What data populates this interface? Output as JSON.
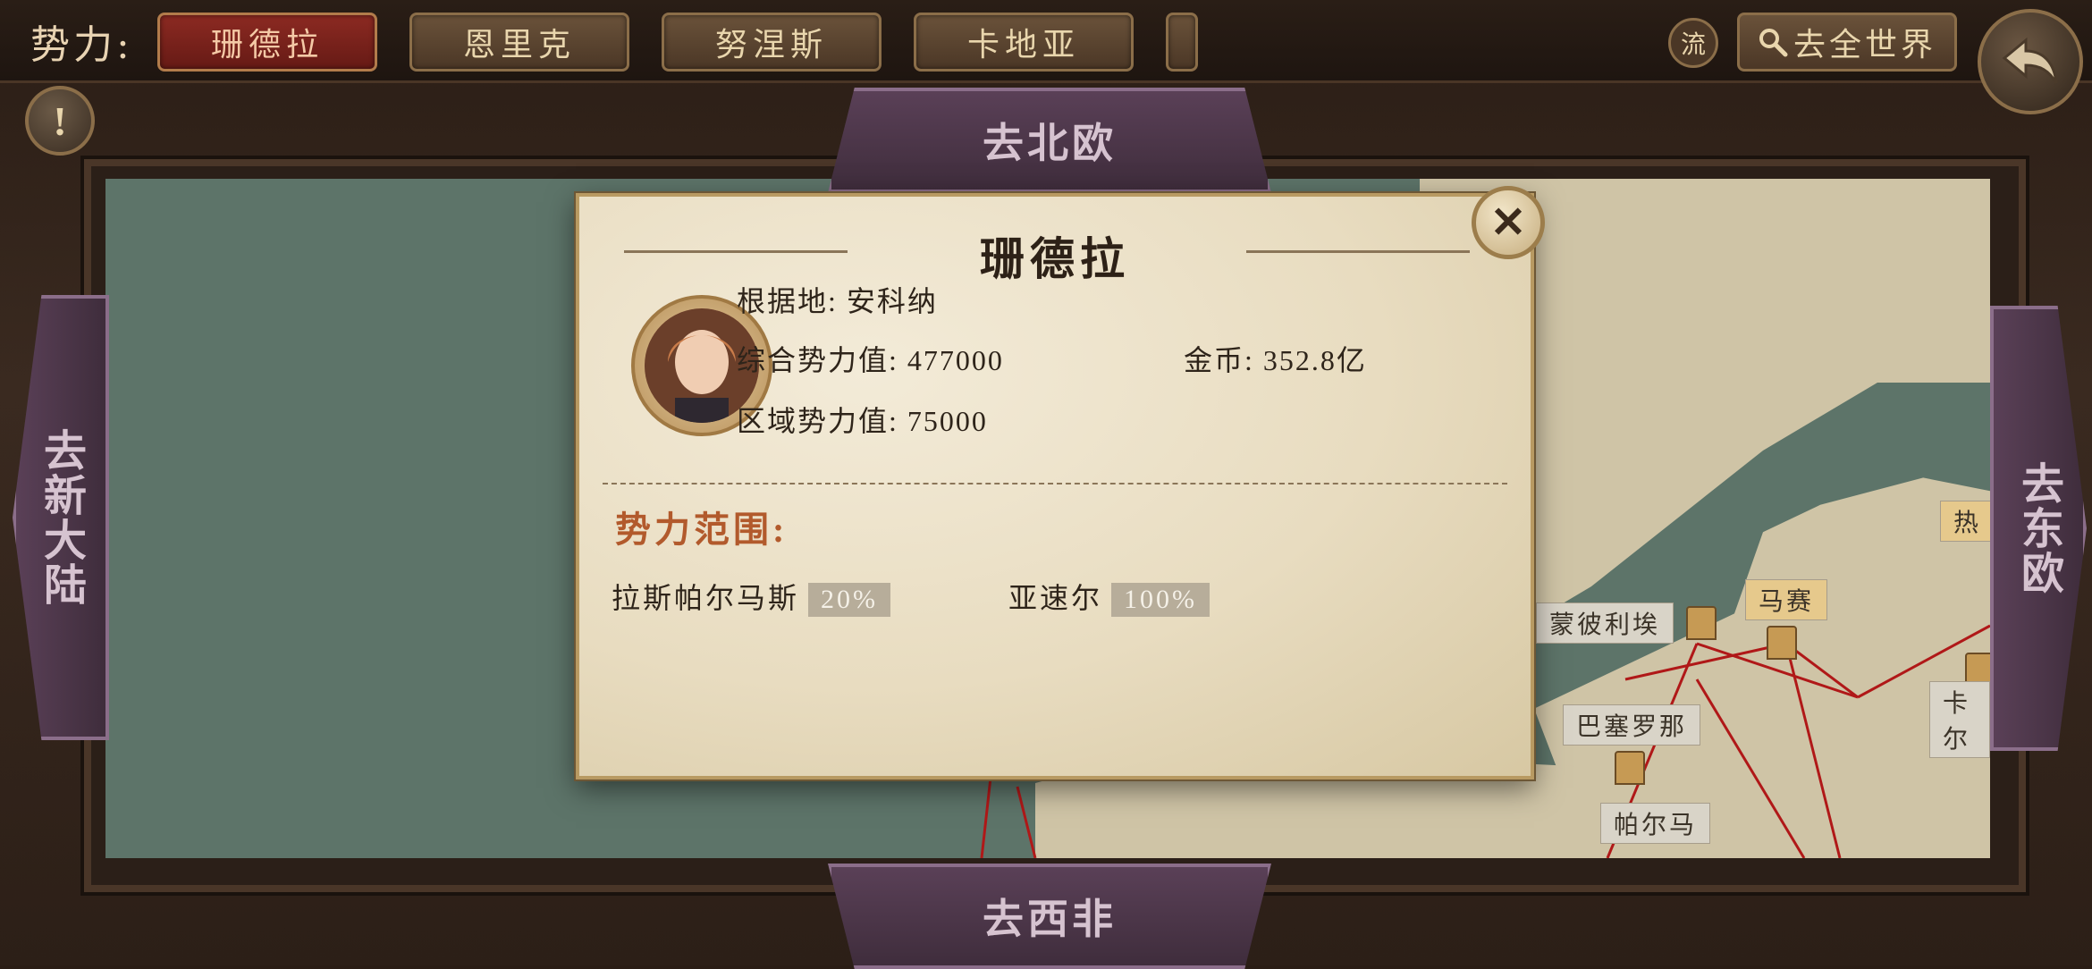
{
  "topbar": {
    "faction_label": "势力:",
    "tabs": [
      {
        "label": "珊德拉",
        "active": true
      },
      {
        "label": "恩里克",
        "active": false
      },
      {
        "label": "努涅斯",
        "active": false
      },
      {
        "label": "卡地亚",
        "active": false
      }
    ],
    "flow_label": "流",
    "world_button": "去全世界",
    "alert_symbol": "!"
  },
  "directions": {
    "north": "去北欧",
    "south": "去西非",
    "west": "去新大陆",
    "east": "去东欧"
  },
  "map": {
    "cities": [
      {
        "name": "蒙彼利埃"
      },
      {
        "name": "马赛"
      },
      {
        "name": "巴塞罗那"
      },
      {
        "name": "帕尔马"
      },
      {
        "name": "卡尔"
      },
      {
        "name": "热"
      }
    ]
  },
  "dialog": {
    "title": "珊德拉",
    "close_symbol": "✕",
    "base_label": "根据地:",
    "base_value": "安科纳",
    "total_power_label": "综合势力值:",
    "total_power_value": "477000",
    "gold_label": "金币:",
    "gold_value": "352.8亿",
    "region_power_label": "区域势力值:",
    "region_power_value": "75000",
    "scope_title": "势力范围:",
    "scope": [
      {
        "city": "拉斯帕尔马斯",
        "percent": "20%"
      },
      {
        "city": "亚速尔",
        "percent": "100%"
      }
    ]
  }
}
